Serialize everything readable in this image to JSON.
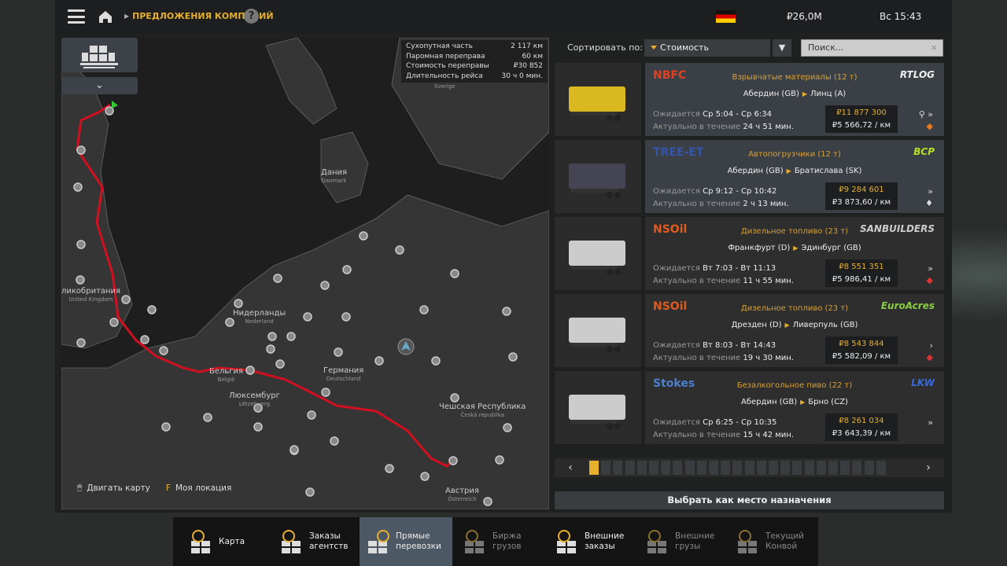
{
  "header": {
    "breadcrumb": "ПРЕДЛОЖЕНИЯ КОМПАНИЙ",
    "help": "?",
    "money": "₽26,0M",
    "time": "Вс 15:43"
  },
  "map": {
    "stats": [
      {
        "label": "Сухопутная часть",
        "value": "2 117 км"
      },
      {
        "label": "Паромная переправа",
        "value": "60 км"
      },
      {
        "label": "Стоимость переправы",
        "value": "₽30 852"
      },
      {
        "label": "Длительность рейса",
        "value": "30 ч 0 мин."
      }
    ],
    "labels": [
      {
        "name": "Дания",
        "sub": "Danmark"
      },
      {
        "name": "ликобритания",
        "sub": "United Kingdom"
      },
      {
        "name": "Нидерланды",
        "sub": "Nederland"
      },
      {
        "name": "Германия",
        "sub": "Deutschland"
      },
      {
        "name": "Бельгия",
        "sub": "België"
      },
      {
        "name": "Люксембург",
        "sub": "Lëtzebuerg"
      },
      {
        "name": "Чешская Республика",
        "sub": "Česká republika"
      },
      {
        "name": "Австрия",
        "sub": "Österreich"
      },
      {
        "name": "Sverige",
        "sub": ""
      }
    ],
    "hint_move": "Двигать карту",
    "hint_key": "F",
    "hint_loc": "Моя локация"
  },
  "sort": {
    "label": "Сортировать по:",
    "value": "Стоимость",
    "search_placeholder": "Поиск...",
    "clear": "×"
  },
  "jobs": [
    {
      "company": "NBFC",
      "client": "RTLOG",
      "cargo": "Взрывчатые материалы (12 т)",
      "from": "Абердин (GB)",
      "to": "Линц (A)",
      "exp_label": "Ожидается",
      "expected": "Ср 5:04 - Ср 6:34",
      "valid_label": "Актуально в течение",
      "valid": "24 ч 51 мин.",
      "price": "₽11 877 300",
      "per_km": "₽5 566,72 / км",
      "icons": "⚲ »",
      "hazard": "◆",
      "color": "#e04020",
      "client_color": "#eee",
      "selected": true,
      "hz": "o"
    },
    {
      "company": "TREE-ET",
      "client": "BCP",
      "cargo": "Автопогрузчики (12 т)",
      "from": "Абердин (GB)",
      "to": "Братислава (SK)",
      "exp_label": "Ожидается",
      "expected": "Ср 9:12 - Ср 10:42",
      "valid_label": "Актуально в течение",
      "valid": "2 ч 13 мин.",
      "price": "₽9 284 601",
      "per_km": "₽3 873,60 / км",
      "icons": "»",
      "hazard": "♦",
      "color": "#3355aa",
      "client_color": "#b8e020",
      "selected": true,
      "hz": ""
    },
    {
      "company": "NSOil",
      "client": "SANBUILDERS",
      "cargo": "Дизельное топливо (23 т)",
      "from": "Франкфурт (D)",
      "to": "Эдинбург (GB)",
      "exp_label": "Ожидается",
      "expected": "Вт 7:03 - Вт 11:13",
      "valid_label": "Актуально в течение",
      "valid": "11 ч 55 мин.",
      "price": "₽8 551 351",
      "per_km": "₽5 986,41 / км",
      "icons": "»",
      "hazard": "◆",
      "color": "#e05a20",
      "client_color": "#ccc",
      "selected": false,
      "hz": "w"
    },
    {
      "company": "NSOil",
      "client": "EuroAcres",
      "cargo": "Дизельное топливо (23 т)",
      "from": "Дрезден (D)",
      "to": "Ливерпуль (GB)",
      "exp_label": "Ожидается",
      "expected": "Вт 8:03 - Вт 14:43",
      "valid_label": "Актуально в течение",
      "valid": "19 ч 30 мин.",
      "price": "₽8 543 844",
      "per_km": "₽5 582,09 / км",
      "icons": "›",
      "hazard": "◆",
      "color": "#e05a20",
      "client_color": "#8c4",
      "selected": false,
      "hz": "w"
    },
    {
      "company": "Stokes",
      "client": "LKW",
      "cargo": "Безалкогольное пиво (22 т)",
      "from": "Абердин (GB)",
      "to": "Брно (CZ)",
      "exp_label": "Ожидается",
      "expected": "Ср 6:25 - Ср 10:35",
      "valid_label": "Актуально в течение",
      "valid": "15 ч 42 мин.",
      "price": "₽8 261 034",
      "per_km": "₽3 643,39 / км",
      "icons": "»",
      "hazard": "",
      "color": "#4a7fd0",
      "client_color": "#3a6ad8",
      "selected": false,
      "hz": ""
    }
  ],
  "pager": {
    "prev": "‹",
    "next": "›",
    "pages": 26,
    "current": 1
  },
  "choose_button": "Выбрать как место назначения",
  "tabs": [
    {
      "line1": "Карта",
      "line2": "",
      "state": "normal"
    },
    {
      "line1": "Заказы",
      "line2": "агентств",
      "state": "normal"
    },
    {
      "line1": "Прямые",
      "line2": "перевозки",
      "state": "active"
    },
    {
      "line1": "Биржа",
      "line2": "грузов",
      "state": "dim"
    },
    {
      "line1": "Внешние",
      "line2": "заказы",
      "state": "normal"
    },
    {
      "line1": "Внешние",
      "line2": "грузы",
      "state": "dim"
    },
    {
      "line1": "Текущий",
      "line2": "Конвой",
      "state": "dim"
    }
  ]
}
